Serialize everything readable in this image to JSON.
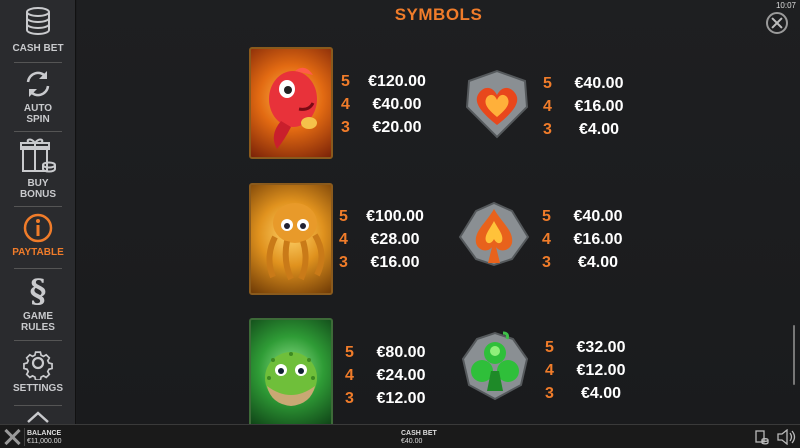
{
  "clock": "10:07",
  "title": "SYMBOLS",
  "sidebar": {
    "items": [
      {
        "label1": "CASH BET",
        "label2": "",
        "icon": "coins-icon"
      },
      {
        "label1": "AUTO",
        "label2": "SPIN",
        "icon": "autospin-icon"
      },
      {
        "label1": "BUY",
        "label2": "BONUS",
        "icon": "gift-icon"
      },
      {
        "label1": "PAYTABLE",
        "label2": "",
        "icon": "info-icon"
      },
      {
        "label1": "GAME",
        "label2": "RULES",
        "icon": "section-icon"
      },
      {
        "label1": "SETTINGS",
        "label2": "",
        "icon": "gear-icon"
      }
    ],
    "active": "PAYTABLE"
  },
  "symbols": [
    {
      "name": "red-fish",
      "pays": [
        {
          "n": "5",
          "v": "€120.00"
        },
        {
          "n": "4",
          "v": "€40.00"
        },
        {
          "n": "3",
          "v": "€20.00"
        }
      ]
    },
    {
      "name": "heart",
      "pays": [
        {
          "n": "5",
          "v": "€40.00"
        },
        {
          "n": "4",
          "v": "€16.00"
        },
        {
          "n": "3",
          "v": "€4.00"
        }
      ]
    },
    {
      "name": "octopus",
      "pays": [
        {
          "n": "5",
          "v": "€100.00"
        },
        {
          "n": "4",
          "v": "€28.00"
        },
        {
          "n": "3",
          "v": "€16.00"
        }
      ]
    },
    {
      "name": "spade",
      "pays": [
        {
          "n": "5",
          "v": "€40.00"
        },
        {
          "n": "4",
          "v": "€16.00"
        },
        {
          "n": "3",
          "v": "€4.00"
        }
      ]
    },
    {
      "name": "pufferfish",
      "pays": [
        {
          "n": "5",
          "v": "€80.00"
        },
        {
          "n": "4",
          "v": "€24.00"
        },
        {
          "n": "3",
          "v": "€12.00"
        }
      ]
    },
    {
      "name": "club",
      "pays": [
        {
          "n": "5",
          "v": "€32.00"
        },
        {
          "n": "4",
          "v": "€12.00"
        },
        {
          "n": "3",
          "v": "€4.00"
        }
      ]
    }
  ],
  "footer": {
    "balance_label": "BALANCE",
    "balance_value": "€11,000.00",
    "cashbet_label": "CASH BET",
    "cashbet_value": "€40.00"
  },
  "colors": {
    "accent": "#f07c2a",
    "background": "#1b1c1e",
    "sidebar": "#2a2b2e"
  }
}
